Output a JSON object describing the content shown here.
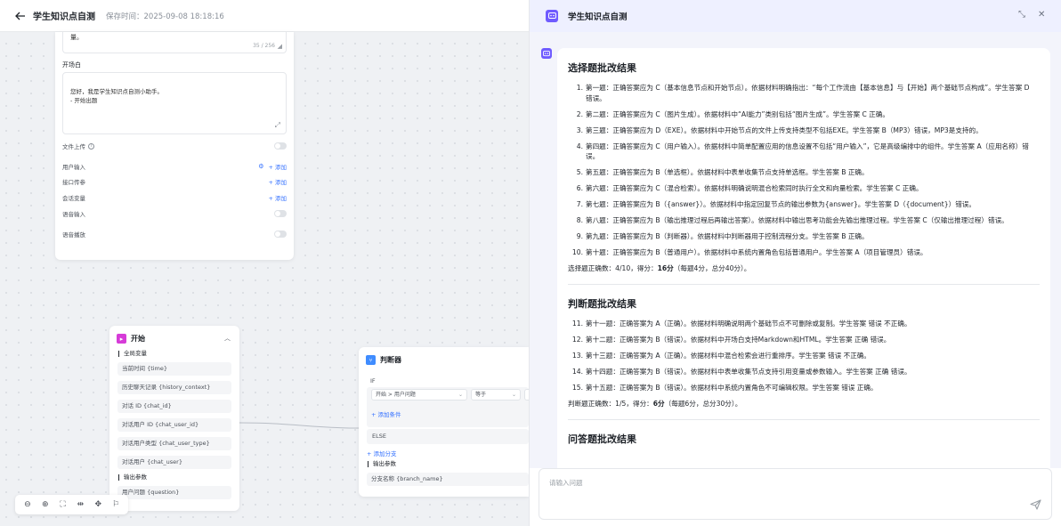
{
  "topbar": {
    "title": "学生知识点自测",
    "save_time": "保存时间：2025-09-08 18:18:16"
  },
  "config": {
    "top_fragment": "量。",
    "char_counter": "35 / 256",
    "opener_label": "开场白",
    "opener_text": "您好，我是学生知识点自测小助手。\n- 开始出题",
    "rows": {
      "file_upload": "文件上传",
      "user_input": "用户输入",
      "api_pass": "接口传参",
      "session_var": "会话变量",
      "voice_input": "语音输入",
      "voice_play": "语音播放"
    },
    "add_label": "+ 添加"
  },
  "start_node": {
    "title": "开始",
    "global_vars_label": "全局变量",
    "vars": [
      "当前时间 {time}",
      "历史聊天记录 {history_context}",
      "对话 ID {chat_id}",
      "对话用户 ID {chat_user_id}",
      "对话用户类型 {chat_user_type}",
      "对话用户 {chat_user}"
    ],
    "output_label": "输出参数",
    "output_vars": [
      "用户问题 {question}"
    ]
  },
  "condition_node": {
    "title": "判断器",
    "if_label": "IF",
    "var_select": "开始 > 用户问题",
    "op_select": "等于",
    "add_condition": "+ 添加条件",
    "else_label": "ELSE",
    "add_branch": "+ 添加分支",
    "output_label": "输出参数",
    "output_var": "分支名称 {branch_name}"
  },
  "zoom_toolbar": [
    "zoom-out-icon",
    "zoom-in-icon",
    "fit-view-icon",
    "layout-icon",
    "drag-icon",
    "debug-icon"
  ],
  "panel": {
    "title": "学生知识点自测",
    "sections": [
      {
        "heading": "选择题批改结果",
        "items": [
          {
            "num": "1.",
            "text": "第一题：正确答案应为 C（基本信息节点和开始节点）。依据材料明确指出：“每个工作流由【基本信息】与【开始】两个基础节点构成”。学生答案 D 错误。"
          },
          {
            "num": "2.",
            "text": "第二题：正确答案应为 C（图片生成）。依据材料中“AI能力”类别包括“图片生成”。学生答案 C 正确。"
          },
          {
            "num": "3.",
            "text": "第三题：正确答案应为 D（EXE）。依据材料中开始节点的文件上传支持类型不包括EXE。学生答案 B（MP3）错误，MP3是支持的。"
          },
          {
            "num": "4.",
            "text": "第四题：正确答案应为 C（用户输入）。依据材料中简单配置应用的信息设置不包括“用户输入”，它是高级编排中的组件。学生答案 A（应用名称）错误。"
          },
          {
            "num": "5.",
            "text": "第五题：正确答案应为 B（单选框）。依据材料中表单收集节点支持单选框。学生答案 B 正确。"
          },
          {
            "num": "6.",
            "text": "第六题：正确答案应为 C（混合检索）。依据材料明确说明混合检索同时执行全文和向量检索。学生答案 C 正确。"
          },
          {
            "num": "7.",
            "text": "第七题：正确答案应为 B（{answer}）。依据材料中指定回复节点的输出参数为{answer}。学生答案 D（{document}）错误。"
          },
          {
            "num": "8.",
            "text": "第八题：正确答案应为 B（输出推理过程后再输出答案）。依据材料中输出思考功能会先输出推理过程。学生答案 C（仅输出推理过程）错误。"
          },
          {
            "num": "9.",
            "text": "第九题：正确答案应为 B（判断器）。依据材料中判断器用于控制流程分支。学生答案 B 正确。"
          },
          {
            "num": "10.",
            "text": "第十题：正确答案应为 B（普通用户）。依据材料中系统内置角色包括普通用户。学生答案 A（项目管理员）错误。"
          }
        ],
        "summary_prefix": "选择题正确数：4/10，得分：",
        "summary_score": "16分",
        "summary_suffix": "（每题4分，总分40分）。"
      },
      {
        "heading": "判断题批改结果",
        "items": [
          {
            "num": "11.",
            "text": "第十一题：正确答案为 A（正确）。依据材料明确说明两个基础节点不可删除或复制。学生答案 错误 不正确。"
          },
          {
            "num": "12.",
            "text": "第十二题：正确答案为 B（错误）。依据材料中开场白支持Markdown和HTML。学生答案 正确 错误。"
          },
          {
            "num": "13.",
            "text": "第十三题：正确答案为 A（正确）。依据材料中混合检索会进行重排序。学生答案 错误 不正确。"
          },
          {
            "num": "14.",
            "text": "第十四题：正确答案为 B（错误）。依据材料中表单收集节点支持引用变量或参数输入。学生答案 正确 错误。"
          },
          {
            "num": "15.",
            "text": "第十五题：正确答案为 B（错误）。依据材料中系统内置角色不可编辑权限。学生答案 错误 正确。"
          }
        ],
        "summary_prefix": "判断题正确数：1/5，得分：",
        "summary_score": "6分",
        "summary_suffix": "（每题6分，总分30分）。"
      },
      {
        "heading": "问答题批改结果",
        "items": []
      }
    ],
    "input_placeholder": "请输入问题"
  },
  "colors": {
    "accent": "#3370ff",
    "bot": "#6f5bff",
    "start_node": "#d63bd8",
    "condition_node": "#3f8cff"
  }
}
